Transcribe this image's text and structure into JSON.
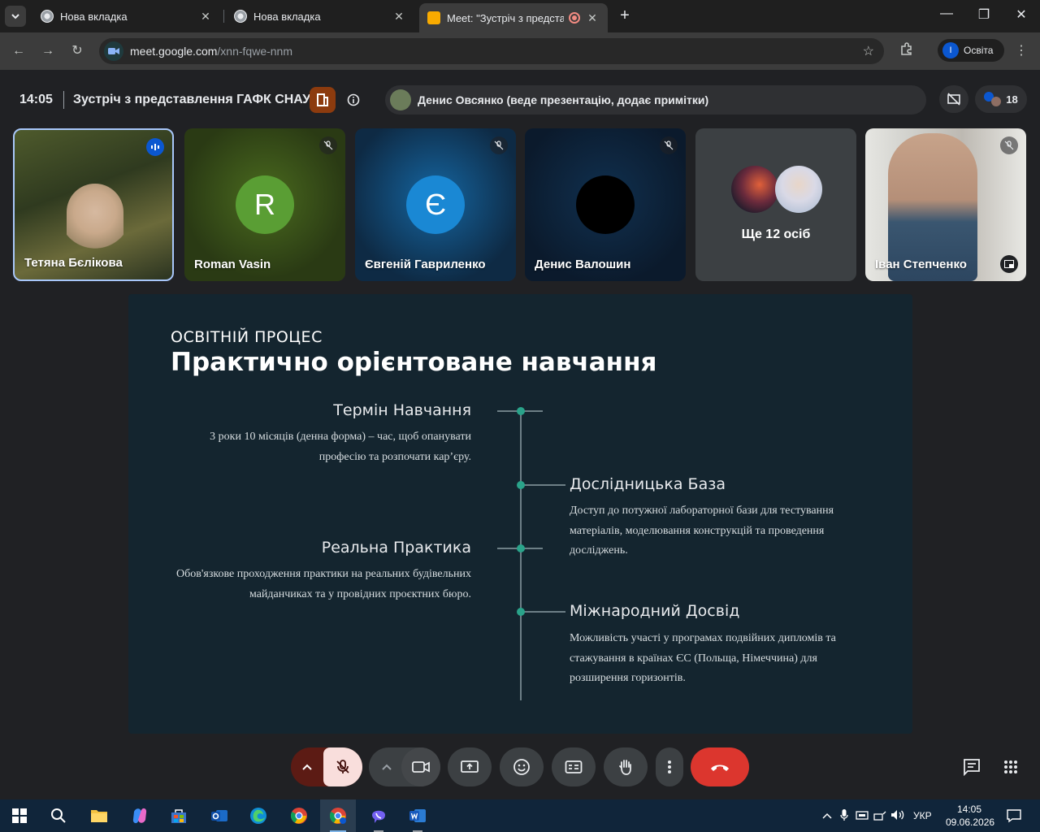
{
  "browser": {
    "tabs": [
      {
        "title": "Нова вкладка"
      },
      {
        "title": "Нова вкладка"
      },
      {
        "title": "Meet: \"Зустріч з представл"
      }
    ],
    "url_host": "meet.google.com",
    "url_path": "/xnn-fqwe-nnm",
    "profile_initial": "I",
    "profile_label": "Освіта"
  },
  "meet": {
    "time": "14:05",
    "title": "Зустріч з представлення ГАФК СНАУ",
    "presenter_text": "Денис Овсянко (веде презентацію, додає примітки)",
    "participant_count": "18",
    "tiles": [
      {
        "name": "Тетяна Бєлікова"
      },
      {
        "name": "Roman Vasin",
        "initial": "R"
      },
      {
        "name": "Євгеній Гавриленко",
        "initial": "Є"
      },
      {
        "name": "Денис Валошин"
      },
      {
        "name": "Ще 12 осіб"
      },
      {
        "name": "Іван Степченко"
      }
    ]
  },
  "slide": {
    "kicker": "ОСВІТНІЙ ПРОЦЕС",
    "title": "Практично орієнтоване навчання",
    "sections": [
      {
        "heading": "Термін Навчання",
        "text": "3 роки 10 місяців (денна форма) – час, щоб опанувати професію та розпочати кар’єру."
      },
      {
        "heading": "Дослідницька База",
        "text": "Доступ до потужної лабораторної бази для тестування матеріалів, моделювання конструкцій та проведення досліджень."
      },
      {
        "heading": "Реальна Практика",
        "text": "Обов'язкове проходження практики на реальних будівельних майданчиках та у провідних проєктних бюро."
      },
      {
        "heading": "Міжнародний Досвід",
        "text": "Можливість участі у програмах подвійних дипломів та стажування в країнах ЄС (Польща, Німеччина) для розширення горизонтів."
      }
    ]
  },
  "taskbar": {
    "language": "УКР",
    "time": "14:05",
    "date": "09.06.2026"
  }
}
